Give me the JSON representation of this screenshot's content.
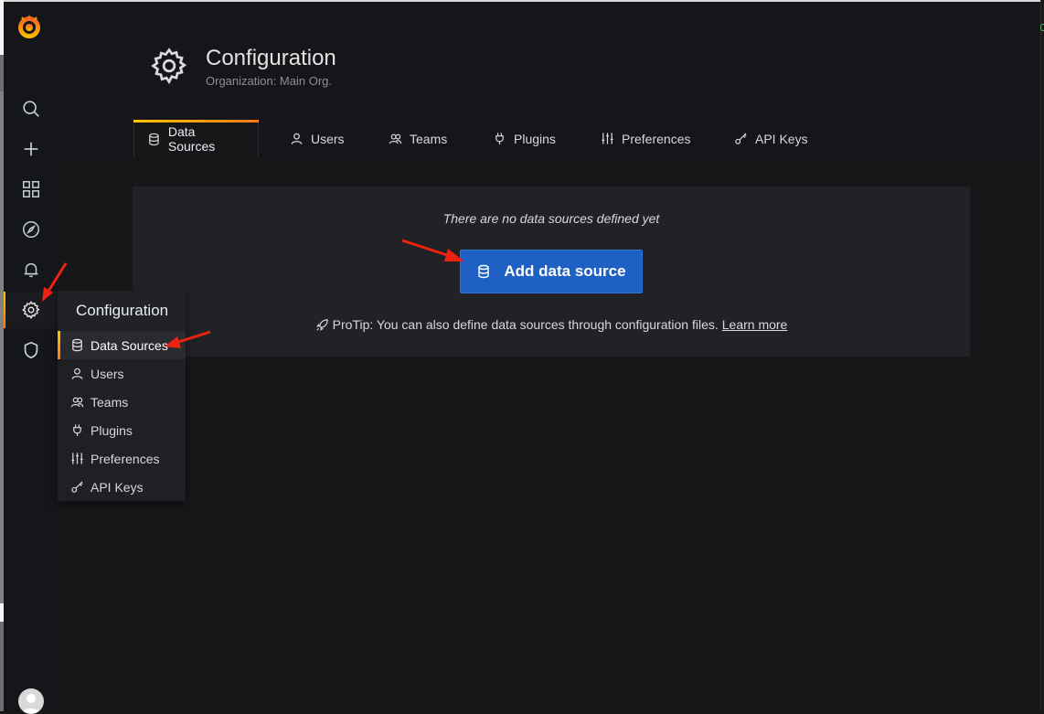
{
  "header": {
    "title": "Configuration",
    "subtitle": "Organization: Main Org."
  },
  "tabs": [
    {
      "label": "Data Sources",
      "icon": "database-icon",
      "active": true
    },
    {
      "label": "Users",
      "icon": "user-icon"
    },
    {
      "label": "Teams",
      "icon": "users-icon"
    },
    {
      "label": "Plugins",
      "icon": "plug-icon"
    },
    {
      "label": "Preferences",
      "icon": "sliders-icon"
    },
    {
      "label": "API Keys",
      "icon": "key-icon"
    }
  ],
  "empty_state": {
    "message": "There are no data sources defined yet",
    "button_label": "Add data source",
    "protip": "ProTip: You can also define data sources through configuration files.",
    "protip_link": "Learn more"
  },
  "sidemenu": {
    "items": [
      "search-icon",
      "plus-icon",
      "apps-icon",
      "compass-icon",
      "bell-icon",
      "cog-icon",
      "shield-icon"
    ],
    "active": "cog-icon"
  },
  "dropdown": {
    "title": "Configuration",
    "items": [
      {
        "label": "Data Sources",
        "icon": "database-icon",
        "active": true
      },
      {
        "label": "Users",
        "icon": "user-icon"
      },
      {
        "label": "Teams",
        "icon": "users-icon"
      },
      {
        "label": "Plugins",
        "icon": "plug-icon"
      },
      {
        "label": "Preferences",
        "icon": "sliders-icon"
      },
      {
        "label": "API Keys",
        "icon": "key-icon"
      }
    ]
  },
  "colors": {
    "accent_gradient_start": "#ffc400",
    "accent_gradient_end": "#ff7a1c",
    "primary_button": "#1f60c4",
    "annotation_arrow": "#ee2211"
  }
}
